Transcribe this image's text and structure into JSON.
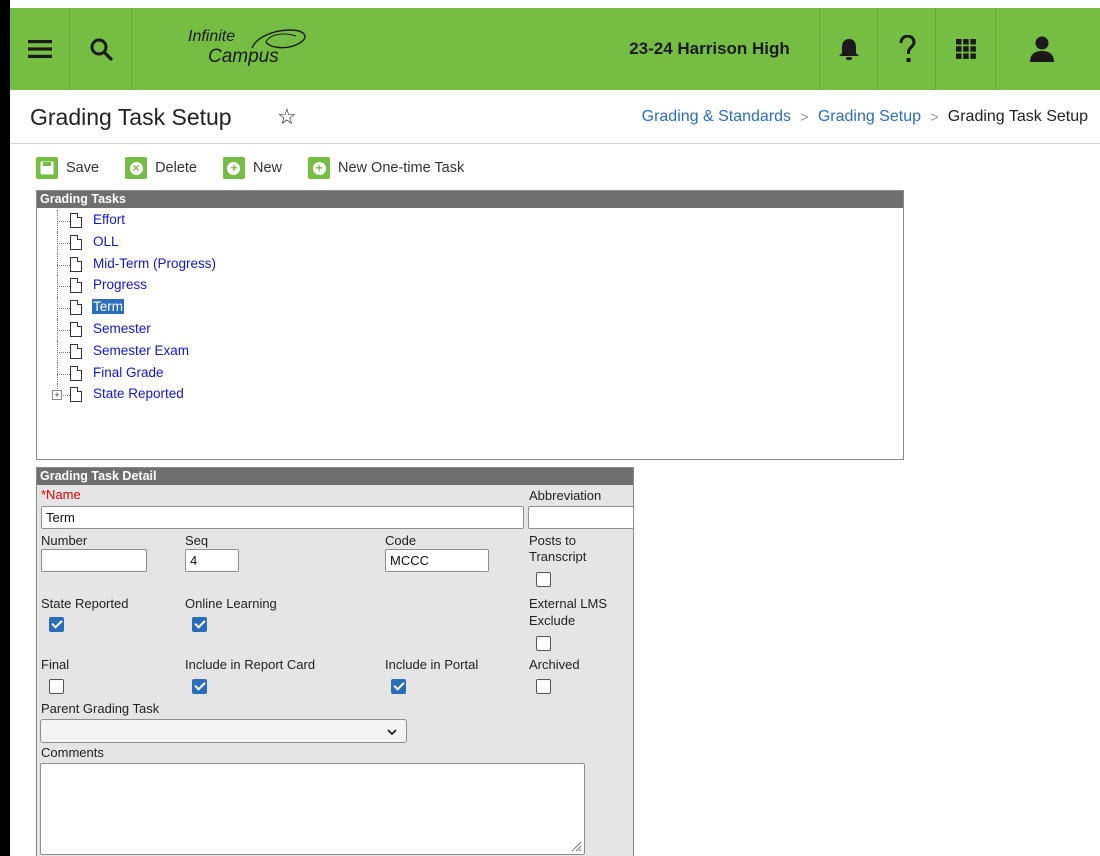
{
  "topbar": {
    "logo_line1": "Infinite",
    "logo_line2": "Campus",
    "school": "23-24 Harrison High",
    "colors": {
      "bar": "#76bd43",
      "icon": "#1a1a1a"
    },
    "icons": [
      "menu-icon",
      "search-icon",
      "bell-icon",
      "help-icon",
      "apps-grid-icon",
      "user-icon"
    ]
  },
  "header": {
    "title": "Grading Task Setup",
    "star_glyph": "☆",
    "breadcrumb": [
      "Grading & Standards",
      "Grading Setup",
      "Grading Task Setup"
    ],
    "separator": ">"
  },
  "toolbar": {
    "save": "Save",
    "delete": "Delete",
    "new": "New",
    "new_one_time": "New One-time Task"
  },
  "tasks": {
    "header": "Grading Tasks",
    "items": [
      {
        "label": "Effort",
        "selected": false,
        "expandable": false
      },
      {
        "label": "OLL",
        "selected": false,
        "expandable": false
      },
      {
        "label": "Mid-Term (Progress)",
        "selected": false,
        "expandable": false
      },
      {
        "label": "Progress",
        "selected": false,
        "expandable": false
      },
      {
        "label": "Term",
        "selected": true,
        "expandable": false
      },
      {
        "label": "Semester",
        "selected": false,
        "expandable": false
      },
      {
        "label": "Semester Exam",
        "selected": false,
        "expandable": false
      },
      {
        "label": "Final Grade",
        "selected": false,
        "expandable": false
      },
      {
        "label": "State Reported",
        "selected": false,
        "expandable": true
      }
    ]
  },
  "detail": {
    "header": "Grading Task Detail",
    "name_label": "*Name",
    "name_value": "Term",
    "abbreviation_label": "Abbreviation",
    "abbreviation_value": "",
    "number_label": "Number",
    "number_value": "",
    "seq_label": "Seq",
    "seq_value": "4",
    "code_label": "Code",
    "code_value": "MCCC",
    "posts_label_1": "Posts to",
    "posts_label_2": "Transcript",
    "posts_checked": false,
    "state_reported_label": "State Reported",
    "state_reported_checked": true,
    "online_learning_label": "Online Learning",
    "online_learning_checked": true,
    "external_lms_label_1": "External LMS",
    "external_lms_label_2": "Exclude",
    "external_lms_checked": false,
    "final_label": "Final",
    "final_checked": false,
    "report_card_label": "Include in Report Card",
    "report_card_checked": true,
    "portal_label": "Include in Portal",
    "portal_checked": true,
    "archived_label": "Archived",
    "archived_checked": false,
    "parent_label": "Parent Grading Task",
    "parent_value": "",
    "comments_label": "Comments",
    "comments_value": ""
  }
}
